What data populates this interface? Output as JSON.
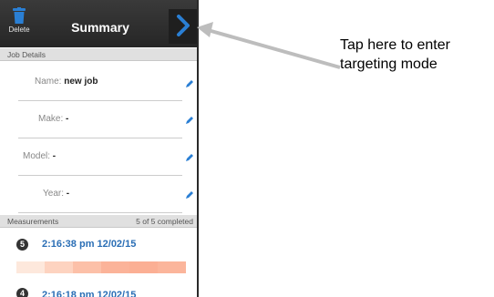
{
  "header": {
    "delete_label": "Delete",
    "title": "Summary"
  },
  "job_details": {
    "section_label": "Job Details",
    "fields": [
      {
        "label": "Name:",
        "value": "new job"
      },
      {
        "label": "Make:",
        "value": "-"
      },
      {
        "label": "Model:",
        "value": "-"
      },
      {
        "label": "Year:",
        "value": "-"
      }
    ]
  },
  "measurements": {
    "section_label": "Measurements",
    "completed": "5 of 5 completed",
    "items": [
      {
        "number": "5",
        "time": "2:16:38 pm 12/02/15"
      },
      {
        "number": "4",
        "time": "2:16:18 pm 12/02/15"
      }
    ],
    "color_segments": [
      "#fde8dc",
      "#fdd3c0",
      "#fcc0a8",
      "#fbb399",
      "#fbaf94",
      "#fbb59b"
    ]
  },
  "annotation": {
    "line1": "Tap here to enter",
    "line2": "targeting mode"
  },
  "colors": {
    "accent_blue": "#2a7fd4",
    "topbar": "#2e2e2e"
  }
}
